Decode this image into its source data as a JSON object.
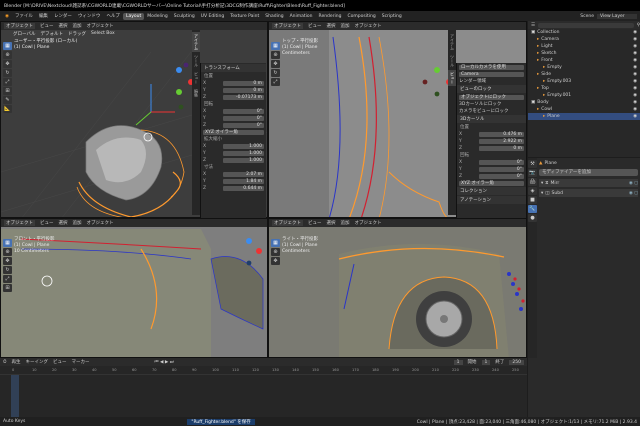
{
  "title": "Blender [M:\\DRIVE\\Nextcloud\\雑誌系\\CGWORLD連載\\CGWORLDサーバー\\Online Tutorial\\手打分析記\\3DCG制作講座\\Ruff\\Fighter\\Blend\\Ruff_Fighter.blend]",
  "menu": [
    "ファイル",
    "編集",
    "レンダー",
    "ウィンドウ",
    "ヘルプ"
  ],
  "workspaces": [
    "Layout",
    "Modeling",
    "Sculpting",
    "UV Editing",
    "Texture Paint",
    "Shading",
    "Animation",
    "Rendering",
    "Compositing",
    "Scripting"
  ],
  "active_workspace": "Layout",
  "scene": "Scene",
  "view_layer": "View Layer",
  "viewports": {
    "tl": {
      "mode": "オブジェクト",
      "menus": [
        "ビュー",
        "選択",
        "追加",
        "オブジェクト"
      ],
      "orient": "グローバル",
      "overlay1": "ユーザー・平行投影 (ローカル)",
      "overlay2": "(1) Cowl | Plane",
      "hdr2": [
        "グローバル",
        "デフォルト",
        "ドラッグ",
        "Select Box"
      ]
    },
    "tr": {
      "mode": "オブジェクト",
      "menus": [
        "ビュー",
        "選択",
        "追加",
        "オブジェクト"
      ],
      "overlay1": "トップ・平行投影",
      "overlay2": "(1) Cowl | Plane",
      "overlay3": "Centimeters"
    },
    "bl": {
      "mode": "オブジェクト",
      "menus": [
        "ビュー",
        "選択",
        "追加",
        "オブジェクト"
      ],
      "overlay1": "フロント・平行投影",
      "overlay2": "(1) Cowl | Plane",
      "overlay3": "10 Centimeters"
    },
    "br": {
      "mode": "オブジェクト",
      "menus": [
        "ビュー",
        "選択",
        "追加",
        "オブジェクト"
      ],
      "overlay1": "ライト・平行投影",
      "overlay2": "(1) Cowl | Plane",
      "overlay3": "Centimeters"
    }
  },
  "transform_panel": {
    "heading": "トランスフォーム",
    "location_label": "位置",
    "location": [
      "0 m",
      "0 m",
      "-0.07173 m"
    ],
    "rotation_label": "回転",
    "rotation": [
      "0°",
      "0°",
      "0°"
    ],
    "mode": "XYZ オイラー角",
    "scale_label": "拡大縮小",
    "scale": [
      "1.000",
      "1.000",
      "1.000"
    ],
    "dims_label": "寸法",
    "dims": [
      "2.07 m",
      "1.84 m",
      "0.644 m"
    ],
    "axes": [
      "X",
      "Y",
      "Z"
    ]
  },
  "view_panel": {
    "view_label": "ビュー",
    "lock_label": "ロック",
    "clip_label": "ローカルカメラを使用",
    "camera": "Camera",
    "render_region": "レンダー領域",
    "lock_to": "ビューのロック",
    "lock_object": "オブジェクトにロック",
    "lock_cursor": "3Dカーソルにロック",
    "lock_camera": "カメラをビューにロック",
    "cursor_heading": "3Dカーソル",
    "cursor_loc_label": "位置",
    "cursor_loc": [
      "0.476 m",
      "2.922 m",
      "0 m"
    ],
    "cursor_rot_label": "回転",
    "cursor_rot": [
      "0°",
      "0°",
      "0°"
    ],
    "cursor_mode": "XYZ オイラー角",
    "collection_heading": "コレクション",
    "annotation_heading": "アノテーション"
  },
  "tabs": [
    "アイテム",
    "ツール",
    "ビュー",
    "編集"
  ],
  "outliner": {
    "items": [
      {
        "name": "Collection",
        "depth": 0,
        "sel": false
      },
      {
        "name": "Camera",
        "depth": 1,
        "sel": false
      },
      {
        "name": "Light",
        "depth": 1,
        "sel": false
      },
      {
        "name": "Sketch",
        "depth": 1,
        "sel": false
      },
      {
        "name": "Front",
        "depth": 1,
        "sel": false
      },
      {
        "name": "Empty",
        "depth": 2,
        "sel": false
      },
      {
        "name": "Side",
        "depth": 1,
        "sel": false
      },
      {
        "name": "Empty.003",
        "depth": 2,
        "sel": false
      },
      {
        "name": "Top",
        "depth": 1,
        "sel": false
      },
      {
        "name": "Empty.001",
        "depth": 2,
        "sel": false
      },
      {
        "name": "Body",
        "depth": 0,
        "sel": false
      },
      {
        "name": "Cowl",
        "depth": 1,
        "sel": false
      },
      {
        "name": "Plane",
        "depth": 2,
        "sel": true
      }
    ]
  },
  "properties": {
    "object": "Plane",
    "add_modifier": "モディファイアーを追加",
    "modifiers": [
      "Mirr",
      "Subd"
    ]
  },
  "timeline": {
    "menus": [
      "再生",
      "キーイング",
      "ビュー",
      "マーカー"
    ],
    "frame": "1",
    "start_label": "開始",
    "start": "1",
    "end_label": "終了",
    "end": "250",
    "ticks": [
      "0",
      "10",
      "20",
      "30",
      "40",
      "50",
      "60",
      "70",
      "80",
      "90",
      "100",
      "110",
      "120",
      "130",
      "140",
      "150",
      "160",
      "170",
      "180",
      "190",
      "200",
      "210",
      "220",
      "230",
      "240",
      "250"
    ]
  },
  "status": {
    "left": "Auto Keys",
    "mid": "\"Ruff_Fighter.blend\" を保存",
    "right": "Cowl | Plane | 頂点:23,428 | 面:23,040 | 三角面:46,080 | オブジェクト:1/13 | メモリ:71.2 MiB | 2.93.4"
  },
  "colors": {
    "accent": "#4772b3",
    "orange": "#ff9a2e",
    "red": "#d22030",
    "blue": "#2a35c8",
    "bg_viewport": "#3d3d3d"
  }
}
